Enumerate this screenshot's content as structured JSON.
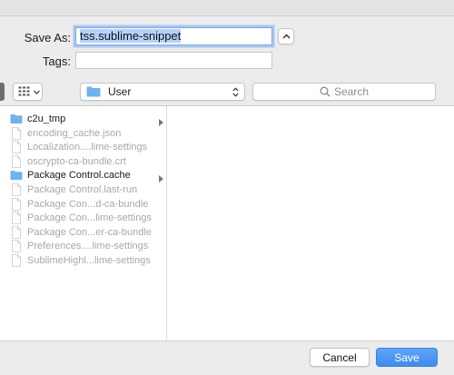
{
  "form": {
    "save_as_label": "Save As:",
    "save_as_value": "tss.sublime-snippet",
    "tags_label": "Tags:",
    "tags_value": ""
  },
  "toolbar": {
    "view_mode_icon": "column-view-icon",
    "location": "User",
    "search_placeholder": "Search"
  },
  "files": [
    {
      "name": "c2u_tmp",
      "type": "folder"
    },
    {
      "name": "encoding_cache.json",
      "type": "file"
    },
    {
      "name": "Localization....lime-settings",
      "type": "file"
    },
    {
      "name": "oscrypto-ca-bundle.crt",
      "type": "file"
    },
    {
      "name": "Package Control.cache",
      "type": "folder"
    },
    {
      "name": "Package Control.last-run",
      "type": "file"
    },
    {
      "name": "Package Con...d-ca-bundle",
      "type": "file"
    },
    {
      "name": "Package Con...lime-settings",
      "type": "file"
    },
    {
      "name": "Package Con...er-ca-bundle",
      "type": "file"
    },
    {
      "name": "Preferences....lime-settings",
      "type": "file"
    },
    {
      "name": "SublimeHighl...lime-settings",
      "type": "file"
    }
  ],
  "buttons": {
    "cancel": "Cancel",
    "save": "Save"
  },
  "colors": {
    "accent": "#3f8cf0",
    "folder": "#6db3ee",
    "dimmed_text": "#a8a8a8"
  }
}
